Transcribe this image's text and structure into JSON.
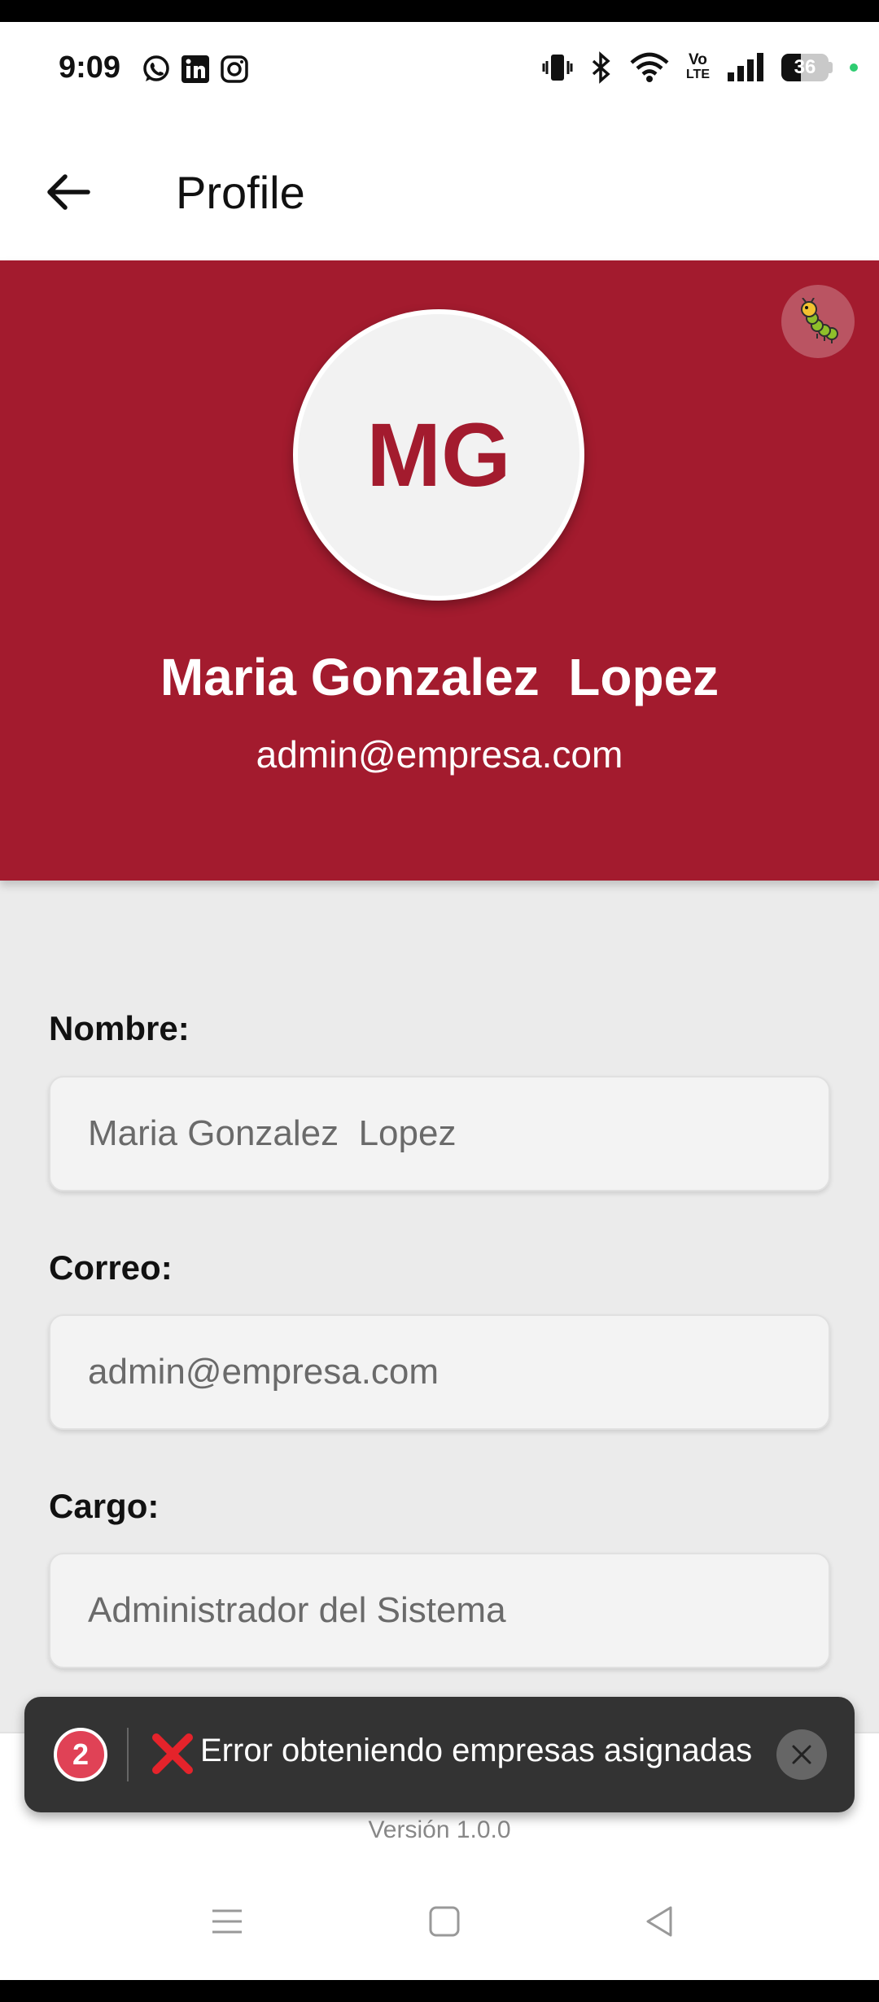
{
  "status_bar": {
    "time": "9:09",
    "battery": "36",
    "icons": [
      "whatsapp-icon",
      "linkedin-icon",
      "instagram-icon",
      "vibrate-icon",
      "bluetooth-icon",
      "wifi-icon",
      "volte-icon",
      "signal-icon",
      "battery-icon"
    ],
    "volte_line1": "Vo",
    "volte_line2": "LTE"
  },
  "app_bar": {
    "title": "Profile",
    "back_icon": "arrow-left-icon"
  },
  "profile": {
    "initials": "MG",
    "name": "Maria Gonzalez  Lopez",
    "email": "admin@empresa.com",
    "debug_icon": "caterpillar-icon"
  },
  "form": {
    "fields": [
      {
        "label": "Nombre:",
        "value": "Maria Gonzalez  Lopez"
      },
      {
        "label": "Correo:",
        "value": "admin@empresa.com"
      },
      {
        "label": "Cargo:",
        "value": "Administrador del Sistema"
      }
    ]
  },
  "toast": {
    "count": "2",
    "message": "Error obteniendo empresas asignadas",
    "icon": "cross-mark-icon"
  },
  "footer": {
    "version": "Versión 1.0.0"
  },
  "colors": {
    "brand": "#a31b2e",
    "toast_bg": "#333333",
    "badge": "#e04256"
  }
}
